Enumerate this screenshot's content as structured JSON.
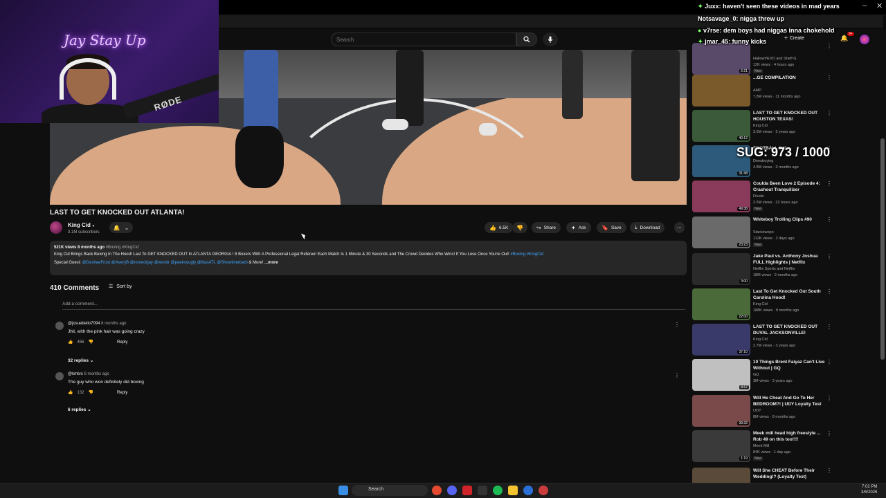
{
  "header": {
    "search_placeholder": "Search",
    "create_label": "Create",
    "notifications_badge": "9+"
  },
  "video": {
    "title": "LAST TO GET KNOCKED OUT ATLANTA!",
    "channel": "King Cid",
    "subscribers": "3.1M subscribers",
    "likes": "6.5K",
    "actions": {
      "share": "Share",
      "ask": "Ask",
      "save": "Save",
      "download": "Download"
    }
  },
  "description": {
    "meta": "521K views  8 months ago",
    "tags": "#Boxing #KingCid",
    "body": "King Cid Brings Back Boxing In The Hood! Last To GET KNOCKED OUT In ATLANTA GEORGIA ! 8 Boxers With A Professional Legal Referee! Each Match Is 1 Minute & 30 Seconds and The Crowd Decides Who Wins! If You Lose Once You're Out!",
    "body_tags": "#Boxing #KingCid",
    "guests_label": "Special Guest:",
    "guests": "@DeshaeFrost @AveryB @noneckjay @wondr @peeksougly @lilasATL @Showtimebarb",
    "guests_more": "& More!",
    "more": "...more"
  },
  "comments": {
    "count": "410 Comments",
    "sort_label": "Sort by",
    "add_placeholder": "Add a comment...",
    "items": [
      {
        "author": "@josuebello7094",
        "ago": "8 months ago",
        "text": "Jhit, with the pink hair was going crazy",
        "likes": "466",
        "reply": "Reply",
        "replies": "32 replies"
      },
      {
        "author": "@kmtvs",
        "ago": "8 months ago",
        "text": "The guy who won definitely did boxing",
        "likes": "132",
        "reply": "Reply",
        "replies": "6 replies"
      }
    ]
  },
  "sidebar": {
    "items": [
      {
        "title": "",
        "channel": "HallowVEVO and Sheff G",
        "meta": "12K views · 4 hours ago",
        "badge": "New",
        "duration": "2:21"
      },
      {
        "title": "...GE COMPILATION",
        "channel": "AMP",
        "meta": "7.8M views · 11 months ago",
        "badge": "",
        "duration": ""
      },
      {
        "title": "LAST TO GET KNOCKED OUT HOUSTON TEXAS!",
        "channel": "King Cid",
        "meta": "3.5M views · 3 years ago",
        "badge": "",
        "duration": "40:12"
      },
      {
        "title": "FOOTBALL 1V1 ...",
        "channel": "Deestroying",
        "meta": "4.8M views · 3 months ago",
        "badge": "",
        "duration": "31:48"
      },
      {
        "title": "Coulda Been Love 2 Episode 4: Crashout Tranquilizer",
        "channel": "Druski",
        "meta": "2.6M views · 22 hours ago",
        "badge": "New",
        "duration": "49:38"
      },
      {
        "title": "Whiteboy Trolling Clips #90",
        "channel": "Stackswopo",
        "meta": "112K views · 2 days ago",
        "badge": "New",
        "duration": "23:23"
      },
      {
        "title": "Jake Paul vs. Anthony Joshua FULL Highlights | Netflix",
        "channel": "Netflix Sports and Netflix",
        "meta": "18M views · 2 months ago",
        "badge": "",
        "duration": "3:00"
      },
      {
        "title": "Last To Get Knocked Out South Carolina Hood!",
        "channel": "King Cid",
        "meta": "188K views · 8 months ago",
        "badge": "",
        "duration": "22:00"
      },
      {
        "title": "LAST TO GET KNOCKED OUT DUVAL JACKSONVILLE!",
        "channel": "King Cid",
        "meta": "2.7M views · 3 years ago",
        "badge": "",
        "duration": "37:10"
      },
      {
        "title": "10 Things Brent Faiyaz Can't Live Without | GQ",
        "channel": "GQ",
        "meta": "3M views · 3 years ago",
        "badge": "",
        "duration": "8:57"
      },
      {
        "title": "Will He Cheat And Go To Her BEDROOM?! | UDY Loyalty Test",
        "channel": "UDY",
        "meta": "8M views · 8 months ago",
        "badge": "",
        "duration": "39:32"
      },
      {
        "title": "Meek mill head high freestyle ... Rob 49 on this too!!!!",
        "channel": "Meek Mill",
        "meta": "84K views · 1 day ago",
        "badge": "New",
        "duration": "1:19"
      },
      {
        "title": "Will She CHEAT Before Their Wedding!? (Loyalty Test)",
        "channel": "",
        "meta": "",
        "badge": "",
        "duration": ""
      }
    ]
  },
  "chat": [
    {
      "user": "Juxx:",
      "msg": "haven't seen these videos in mad years"
    },
    {
      "user": "Notsavage_0:",
      "msg": "nigga threw up"
    },
    {
      "user": "v7rse:",
      "msg": "dem boys had niggas inna chokehold"
    },
    {
      "user": "jmar_45:",
      "msg": "funny kicks"
    }
  ],
  "overlay": {
    "sug_counter": "SUG: 973 / 1000",
    "cam_logo": "Jay Stay Up",
    "mic_brand": "RØDE"
  },
  "taskbar": {
    "search": "Search",
    "time": "7:02 PM",
    "date": "3/6/2026"
  }
}
